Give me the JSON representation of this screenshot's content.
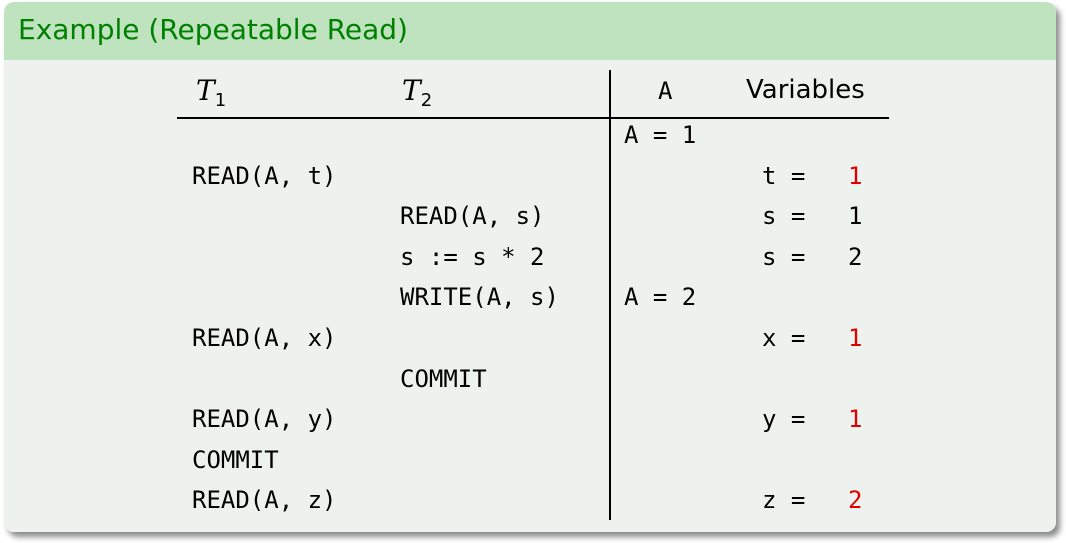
{
  "title": "Example (Repeatable Read)",
  "headers": {
    "t1": "T",
    "t1_sub": "1",
    "t2": "T",
    "t2_sub": "2",
    "a": "A",
    "variables": "Variables"
  },
  "rows": [
    {
      "t1": "",
      "t2": "",
      "a": "A = 1",
      "var_name": "",
      "var_value": ""
    },
    {
      "t1": "READ(A, t)",
      "t2": "",
      "a": "",
      "var_name": "t = ",
      "var_value": "1"
    },
    {
      "t1": "",
      "t2": "READ(A, s)",
      "a": "",
      "var_name": "s = ",
      "var_value": "1"
    },
    {
      "t1": "",
      "t2": "s := s * 2",
      "a": "",
      "var_name": "s = ",
      "var_value": "2"
    },
    {
      "t1": "",
      "t2": "WRITE(A, s)",
      "a": "A = 2",
      "var_name": "",
      "var_value": ""
    },
    {
      "t1": "READ(A, x)",
      "t2": "",
      "a": "",
      "var_name": "x = ",
      "var_value": "1"
    },
    {
      "t1": "",
      "t2": "COMMIT",
      "a": "",
      "var_name": "",
      "var_value": ""
    },
    {
      "t1": "READ(A, y)",
      "t2": "",
      "a": "",
      "var_name": "y = ",
      "var_value": "1"
    },
    {
      "t1": "COMMIT",
      "t2": "",
      "a": "",
      "var_name": "",
      "var_value": ""
    },
    {
      "t1": "READ(A, z)",
      "t2": "",
      "a": "",
      "var_name": "z = ",
      "var_value": "2"
    }
  ],
  "colors": {
    "title_text": "#008000",
    "title_bar": "#bfe3bf",
    "highlight": "#e00000"
  }
}
